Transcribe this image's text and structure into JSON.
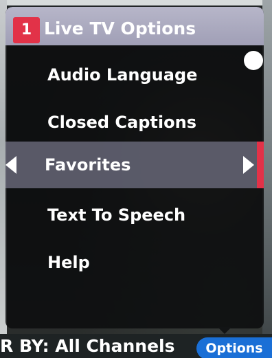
{
  "menu": {
    "badge": "1",
    "title": "Live TV Options",
    "items": [
      {
        "label": "Audio Language"
      },
      {
        "label": "Closed Captions"
      },
      {
        "label": "Favorites"
      },
      {
        "label": "Text To Speech"
      },
      {
        "label": "Help"
      }
    ],
    "selected_index": 2
  },
  "bottom_bar": {
    "filter_text": "R BY: All Channels",
    "options_label": "Options"
  },
  "colors": {
    "accent_red": "#e23248",
    "header_lavender": "#a09fb6",
    "options_blue": "#1a6fd6"
  }
}
